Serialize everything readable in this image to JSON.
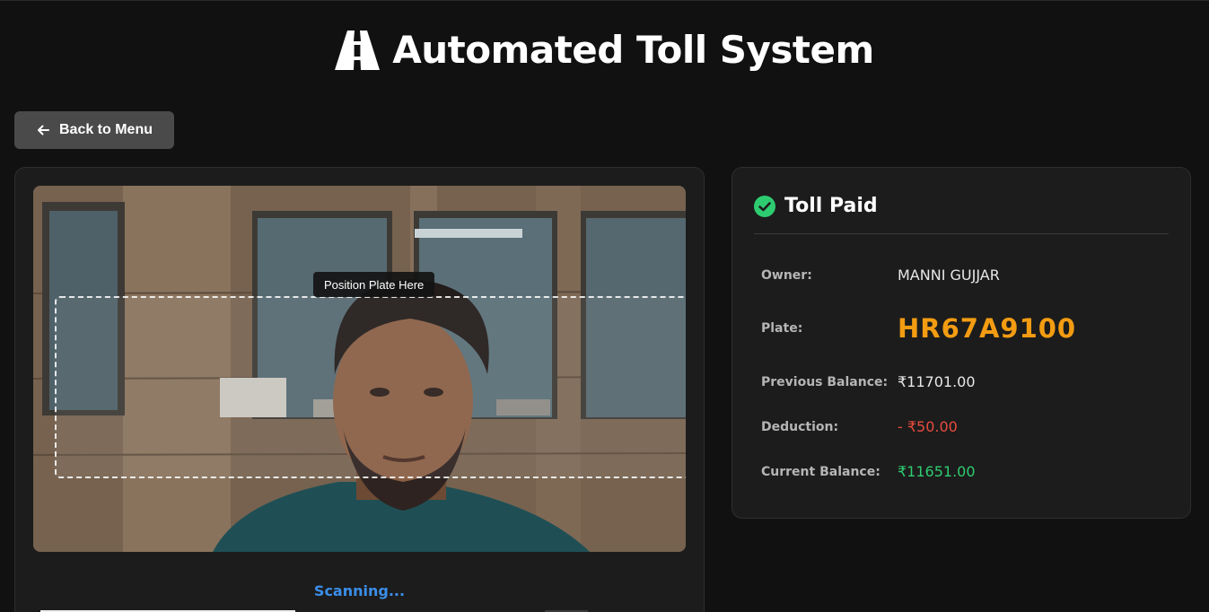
{
  "header": {
    "title": "Automated Toll System",
    "icon": "road-icon"
  },
  "nav": {
    "back_label": "Back to Menu",
    "back_icon": "arrow-left-icon"
  },
  "camera": {
    "overlay_label": "Position Plate Here",
    "status_text": "Scanning...",
    "status_color": "#3b8ee8",
    "scan_progress": 0.4
  },
  "result": {
    "title": "Toll Paid",
    "status_icon": "check-circle-icon",
    "status_color": "#2ecc71",
    "rows": [
      {
        "label": "Owner:",
        "value": "MANNI GUJJAR"
      },
      {
        "label": "Plate:",
        "value": "HR67A9100"
      },
      {
        "label": "Previous Balance:",
        "value": "₹11701.00"
      },
      {
        "label": "Deduction:",
        "value": "- ₹50.00"
      },
      {
        "label": "Current Balance:",
        "value": "₹11651.00"
      }
    ]
  },
  "colors": {
    "background": "#111111",
    "card": "#1c1c1c",
    "plate": "#f39c12",
    "deduction": "#e74c3c",
    "balance": "#2ecc71"
  }
}
